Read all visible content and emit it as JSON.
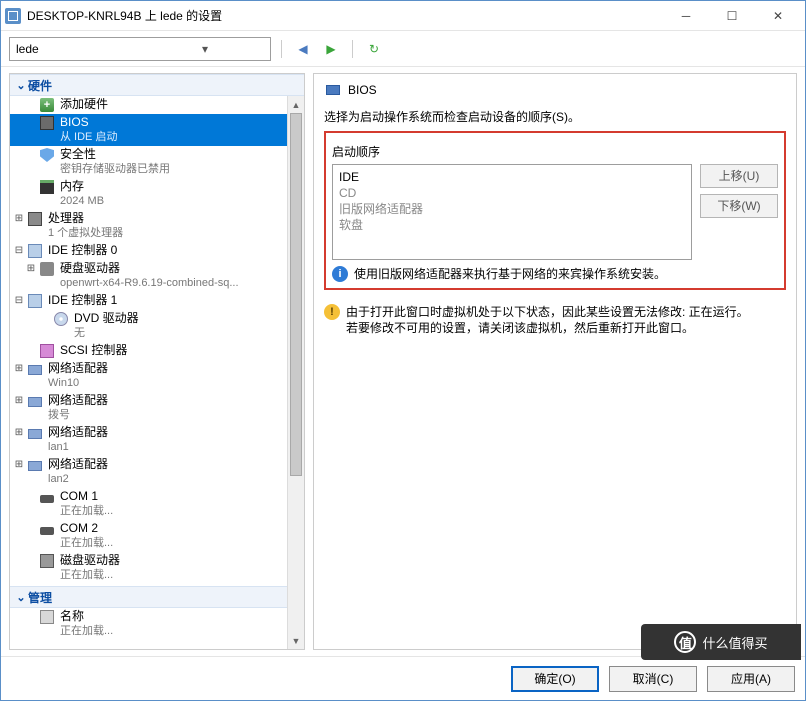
{
  "window": {
    "title": "DESKTOP-KNRL94B 上 lede 的设置"
  },
  "toolbar": {
    "vm_name": "lede"
  },
  "sections": {
    "hardware": "硬件",
    "management": "管理"
  },
  "tree": {
    "add_hw": "添加硬件",
    "bios": {
      "label": "BIOS",
      "sub": "从 IDE 启动"
    },
    "security": {
      "label": "安全性",
      "sub": "密钥存储驱动器已禁用"
    },
    "memory": {
      "label": "内存",
      "sub": "2024 MB"
    },
    "cpu": {
      "label": "处理器",
      "sub": "1 个虚拟处理器"
    },
    "ide0": {
      "label": "IDE 控制器 0"
    },
    "hdd": {
      "label": "硬盘驱动器",
      "sub": "openwrt-x64-R9.6.19-combined-sq..."
    },
    "ide1": {
      "label": "IDE 控制器 1"
    },
    "dvd": {
      "label": "DVD 驱动器",
      "sub": "无"
    },
    "scsi": {
      "label": "SCSI 控制器"
    },
    "nic1": {
      "label": "网络适配器",
      "sub": "Win10"
    },
    "nic2": {
      "label": "网络适配器",
      "sub": "拨号"
    },
    "nic3": {
      "label": "网络适配器",
      "sub": "lan1"
    },
    "nic4": {
      "label": "网络适配器",
      "sub": "lan2"
    },
    "com1": {
      "label": "COM 1",
      "sub": "正在加载..."
    },
    "com2": {
      "label": "COM 2",
      "sub": "正在加载..."
    },
    "floppy": {
      "label": "磁盘驱动器",
      "sub": "正在加载..."
    },
    "name": {
      "label": "名称",
      "sub": "正在加载..."
    }
  },
  "right": {
    "header": "BIOS",
    "desc": "选择为启动操作系统而检查启动设备的顺序(S)。",
    "group_label": "启动顺序",
    "boot_items": [
      "IDE",
      "CD",
      "旧版网络适配器",
      "软盘"
    ],
    "move_up": "上移(U)",
    "move_down": "下移(W)",
    "info1": "使用旧版网络适配器来执行基于网络的来宾操作系统安装。",
    "warn1": "由于打开此窗口时虚拟机处于以下状态，因此某些设置无法修改: 正在运行。",
    "warn2": "若要修改不可用的设置，请关闭该虚拟机，然后重新打开此窗口。"
  },
  "footer": {
    "ok": "确定(O)",
    "cancel": "取消(C)",
    "apply": "应用(A)"
  },
  "watermark": "什么值得买"
}
